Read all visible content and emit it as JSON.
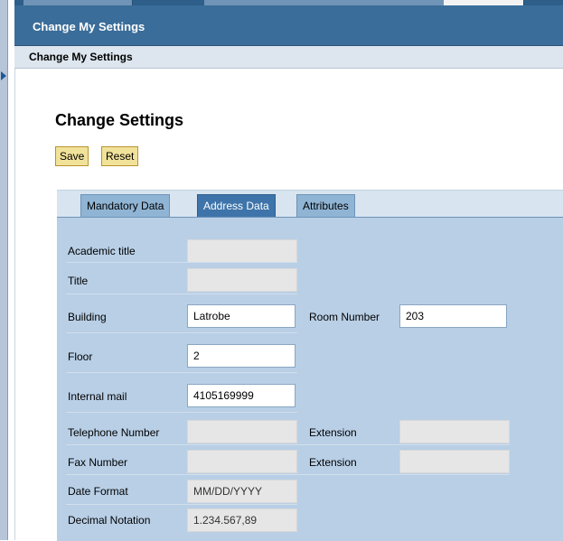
{
  "header": {
    "bar_title": "Change My Settings",
    "page_title": "Change My Settings",
    "section_heading": "Change Settings"
  },
  "actions": {
    "save": "Save",
    "reset": "Reset"
  },
  "tabs": [
    {
      "label": "Mandatory Data",
      "active": false
    },
    {
      "label": "Address Data",
      "active": true
    },
    {
      "label": "Attributes",
      "active": false
    }
  ],
  "form": {
    "academic_title": {
      "label": "Academic title",
      "value": ""
    },
    "title": {
      "label": "Title",
      "value": ""
    },
    "building": {
      "label": "Building",
      "value": "Latrobe"
    },
    "room_number": {
      "label": "Room Number",
      "value": "203"
    },
    "floor": {
      "label": "Floor",
      "value": "2"
    },
    "internal_mail": {
      "label": "Internal mail",
      "value": "4105169999"
    },
    "telephone": {
      "label": "Telephone Number",
      "value": ""
    },
    "telephone_ext": {
      "label": "Extension",
      "value": ""
    },
    "fax": {
      "label": "Fax Number",
      "value": ""
    },
    "fax_ext": {
      "label": "Extension",
      "value": ""
    },
    "date_format": {
      "label": "Date Format",
      "value": "MM/DD/YYYY"
    },
    "decimal_notation": {
      "label": "Decimal Notation",
      "value": "1.234.567,89"
    }
  },
  "icons": {
    "nav_toggle": "triangle-right-icon"
  },
  "colors": {
    "header_blue": "#3a6d99",
    "active_tab": "#3e74aa",
    "panel_bg": "#b8cfe6",
    "button_bg": "#f1e29a"
  }
}
